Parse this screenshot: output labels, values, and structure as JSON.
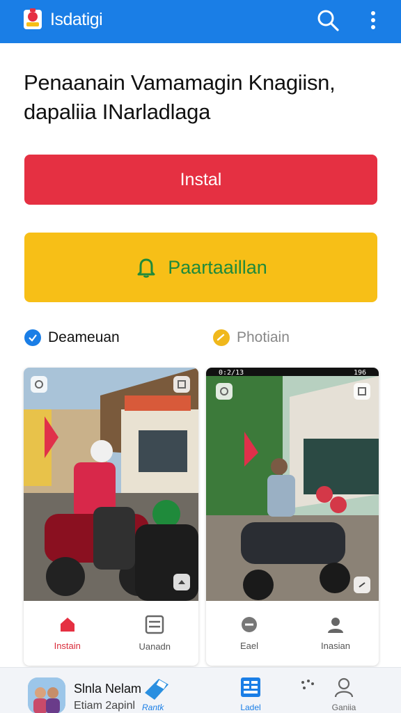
{
  "app": {
    "title": "Isdatigi"
  },
  "headline": "Penaanain Vamamagin Knagiisn, dapaliia INarladlaga",
  "buttons": {
    "install": "Instal",
    "notify": "Paartaaillan"
  },
  "tabs": [
    {
      "label": "Deameuan",
      "active": true
    },
    {
      "label": "Photiain",
      "active": false
    }
  ],
  "cards": [
    {
      "actions": [
        {
          "label": "Instain"
        },
        {
          "label": "Uanadn"
        }
      ]
    },
    {
      "status_time": "0:2/13",
      "status_right": "196",
      "actions": [
        {
          "label": "Eael"
        },
        {
          "label": "Inasian"
        }
      ]
    }
  ],
  "bottom_nav": {
    "user_name": "Slnla Nelam",
    "user_sub": "Etiam 2apinl",
    "badge_label": "Rantk",
    "items": [
      {
        "label": "Ladel",
        "active": true
      },
      {
        "label": "Ganiia",
        "active": false
      }
    ]
  },
  "colors": {
    "primary": "#1a7ee6",
    "install": "#e53042",
    "notify": "#f7bf17",
    "notify_text": "#1f8a3b"
  },
  "icons": [
    "app-logo",
    "search-icon",
    "more-vertical-icon",
    "bell-icon",
    "check-icon",
    "expand-icon",
    "home-icon",
    "list-icon",
    "minus-circle-icon",
    "user-icon",
    "grid-icon",
    "dots-icon"
  ]
}
